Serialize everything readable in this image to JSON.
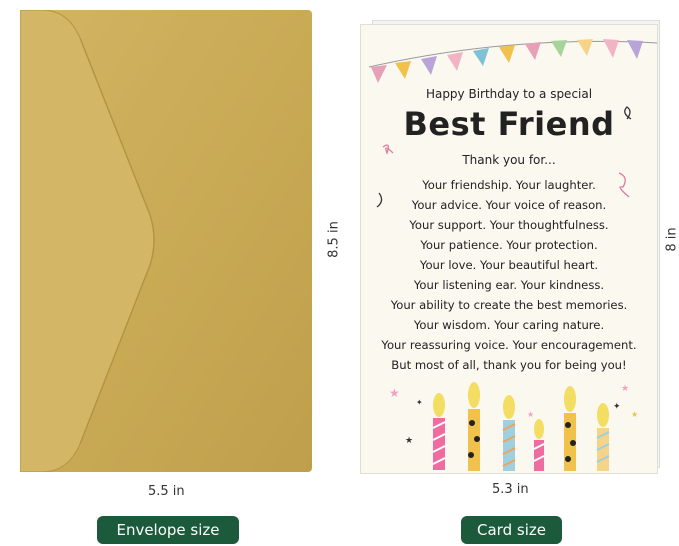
{
  "envelope": {
    "width_label": "5.5 in",
    "height_label": "8.5 in",
    "caption": "Envelope size",
    "color": "#c9aa55"
  },
  "card": {
    "width_label": "5.3 in",
    "height_label": "8 in",
    "caption": "Card size",
    "intro": "Happy Birthday to a special",
    "headline": "Best Friend",
    "thanks": "Thank you for...",
    "lines": [
      "Your friendship. Your laughter.",
      "Your advice. Your voice of reason.",
      "Your support. Your thoughtfulness.",
      "Your patience. Your protection.",
      "Your love. Your beautiful heart.",
      "Your listening ear. Your kindness.",
      "Your ability to create the best memories.",
      "Your wisdom. Your caring nature.",
      "Your reassuring voice. Your encouragement.",
      "But most of all, thank you for being you!"
    ]
  },
  "caption_color": "#1b5a3a"
}
